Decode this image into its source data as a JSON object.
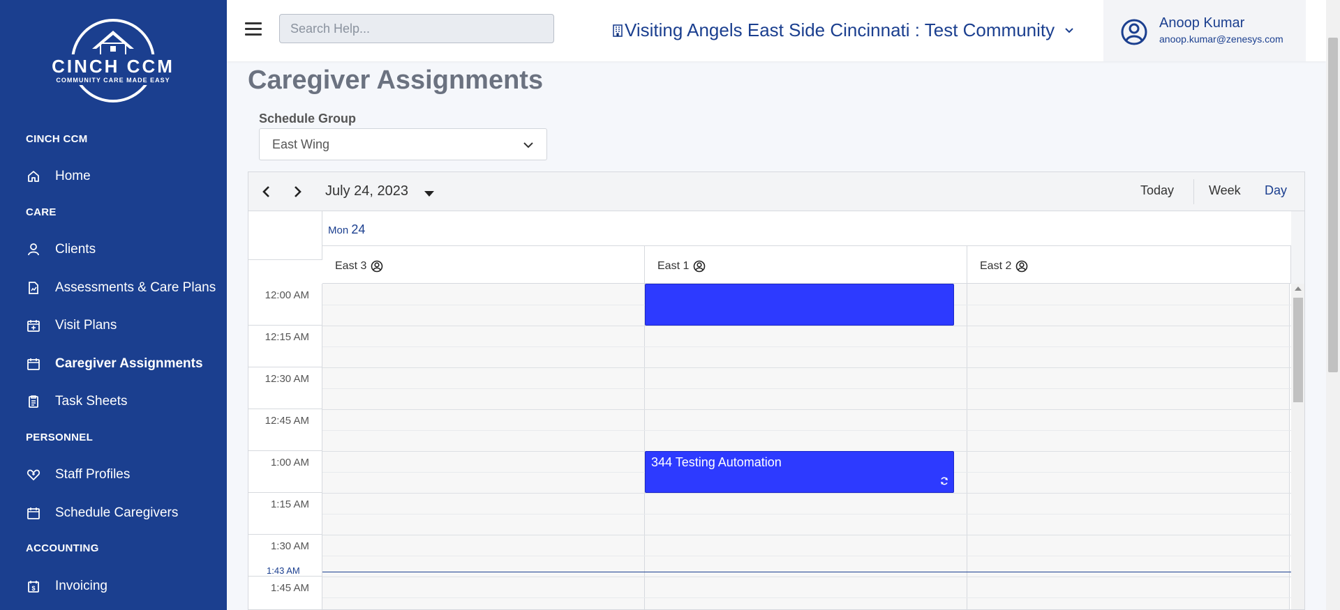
{
  "sidebar": {
    "logo_text": "CINCH CCM",
    "logo_tagline": "COMMUNITY CARE MADE EASY",
    "sections": [
      {
        "label": "CINCH CCM"
      },
      {
        "label": "CARE"
      },
      {
        "label": "PERSONNEL"
      },
      {
        "label": "ACCOUNTING"
      }
    ],
    "items": [
      {
        "label": "Home",
        "icon": "home-icon"
      },
      {
        "label": "Clients",
        "icon": "person-icon"
      },
      {
        "label": "Assessments & Care Plans",
        "icon": "document-chart-icon"
      },
      {
        "label": "Visit Plans",
        "icon": "calendar-plus-icon"
      },
      {
        "label": "Caregiver Assignments",
        "icon": "calendar-icon",
        "active": true
      },
      {
        "label": "Task Sheets",
        "icon": "clipboard-icon"
      },
      {
        "label": "Staff Profiles",
        "icon": "heart-badge-icon"
      },
      {
        "label": "Schedule Caregivers",
        "icon": "calendar-icon"
      },
      {
        "label": "Invoicing",
        "icon": "invoice-icon"
      }
    ]
  },
  "header": {
    "search_placeholder": "Search Help...",
    "community": "Visiting Angels East Side Cincinnati : Test Community",
    "user_name": "Anoop Kumar",
    "user_email": "anoop.kumar@zenesys.com"
  },
  "main": {
    "title": "Caregiver Assignments",
    "schedule_group_label": "Schedule Group",
    "schedule_group_value": "East Wing"
  },
  "scheduler": {
    "date": "July 24, 2023",
    "views": {
      "today": "Today",
      "week": "Week",
      "day": "Day"
    },
    "active_view": "Day",
    "day_name": "Mon",
    "day_number": "24",
    "resources": [
      "East 3",
      "East 1",
      "East 2"
    ],
    "time_slots": [
      "12:00 AM",
      "12:15 AM",
      "12:30 AM",
      "12:45 AM",
      "1:00 AM",
      "1:15 AM",
      "1:30 AM",
      "1:45 AM"
    ],
    "now_label": "1:43 AM",
    "events": [
      {
        "title": "",
        "resource": "East 1",
        "start": "12:00 AM",
        "end": "12:15 AM",
        "recurring": false
      },
      {
        "title": "344 Testing Automation",
        "resource": "East 1",
        "start": "1:00 AM",
        "end": "1:15 AM",
        "recurring": true
      }
    ],
    "colors": {
      "event": "#2d3aff",
      "brand": "#1b3f8f"
    }
  }
}
